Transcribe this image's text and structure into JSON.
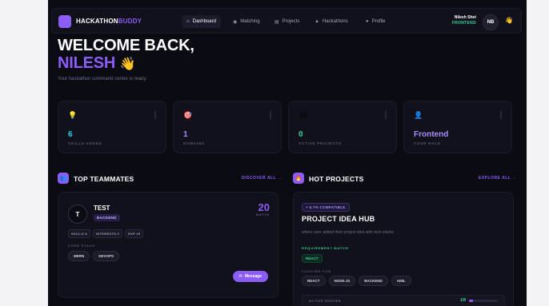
{
  "brand": {
    "part1": "HACKATHON",
    "part2": "BUDDY"
  },
  "nav": [
    {
      "label": "Dashboard",
      "icon": "⌂",
      "active": true
    },
    {
      "label": "Matching",
      "icon": "◉",
      "active": false
    },
    {
      "label": "Projects",
      "icon": "▤",
      "active": false
    },
    {
      "label": "Hackathons",
      "icon": "▲",
      "active": false
    },
    {
      "label": "Profile",
      "icon": "●",
      "active": false
    }
  ],
  "user": {
    "name": "Nilesh Shet",
    "role": "FRONTEND",
    "initials": "NB",
    "wave": "👋"
  },
  "welcome": {
    "line1": "WELCOME BACK,",
    "name": "NILESH",
    "emoji": "👋",
    "subtitle": "Your hackathon command center is ready."
  },
  "stats": [
    {
      "icon": "💡",
      "value": "6",
      "label": "SKILLS ADDED",
      "color": "#22d3ee"
    },
    {
      "icon": "🎯",
      "value": "1",
      "label": "DOMAINS",
      "color": "#a78bfa"
    },
    {
      "icon": "🛠",
      "value": "0",
      "label": "ACTIVE PROJECTS",
      "color": "#34d399"
    },
    {
      "icon": "👤",
      "value": "Frontend",
      "label": "YOUR ROLE",
      "color": "#a78bfa"
    }
  ],
  "teammates": {
    "title": "TOP TEAMMATES",
    "link": "DISCOVER ALL →",
    "card": {
      "initial": "T",
      "name": "TEST",
      "role": "BACKEND",
      "match": "20",
      "match_label": "MATCH",
      "chips": [
        "SKILLS 8",
        "INTERESTS 0",
        "EXP 20"
      ],
      "core_label": "CORE STACK",
      "stack": [
        "MERN",
        "DEVOPS"
      ],
      "message": "Message"
    }
  },
  "projects": {
    "title": "HOT PROJECTS",
    "link": "EXPLORE ALL →",
    "card": {
      "compat": "+ 6.7% COMPATIBLE",
      "title": "PROJECT IDEA HUB",
      "desc": "where user added their project idea with tech stacks",
      "req_label": "REQUIREMENT MATCH",
      "req": "REACT",
      "looking_label": "LOOKING FOR",
      "looking": [
        "REACT",
        "NODE.JS",
        "BACKEND",
        "AIML"
      ],
      "active_label": "ACTIVE ROSTER",
      "active_value": "1/8",
      "active_fraction": 0.125
    }
  },
  "colors": {
    "accent": "#8b5cf6",
    "bg": "#0b0b14",
    "green": "#34d399",
    "cyan": "#22d3ee"
  }
}
